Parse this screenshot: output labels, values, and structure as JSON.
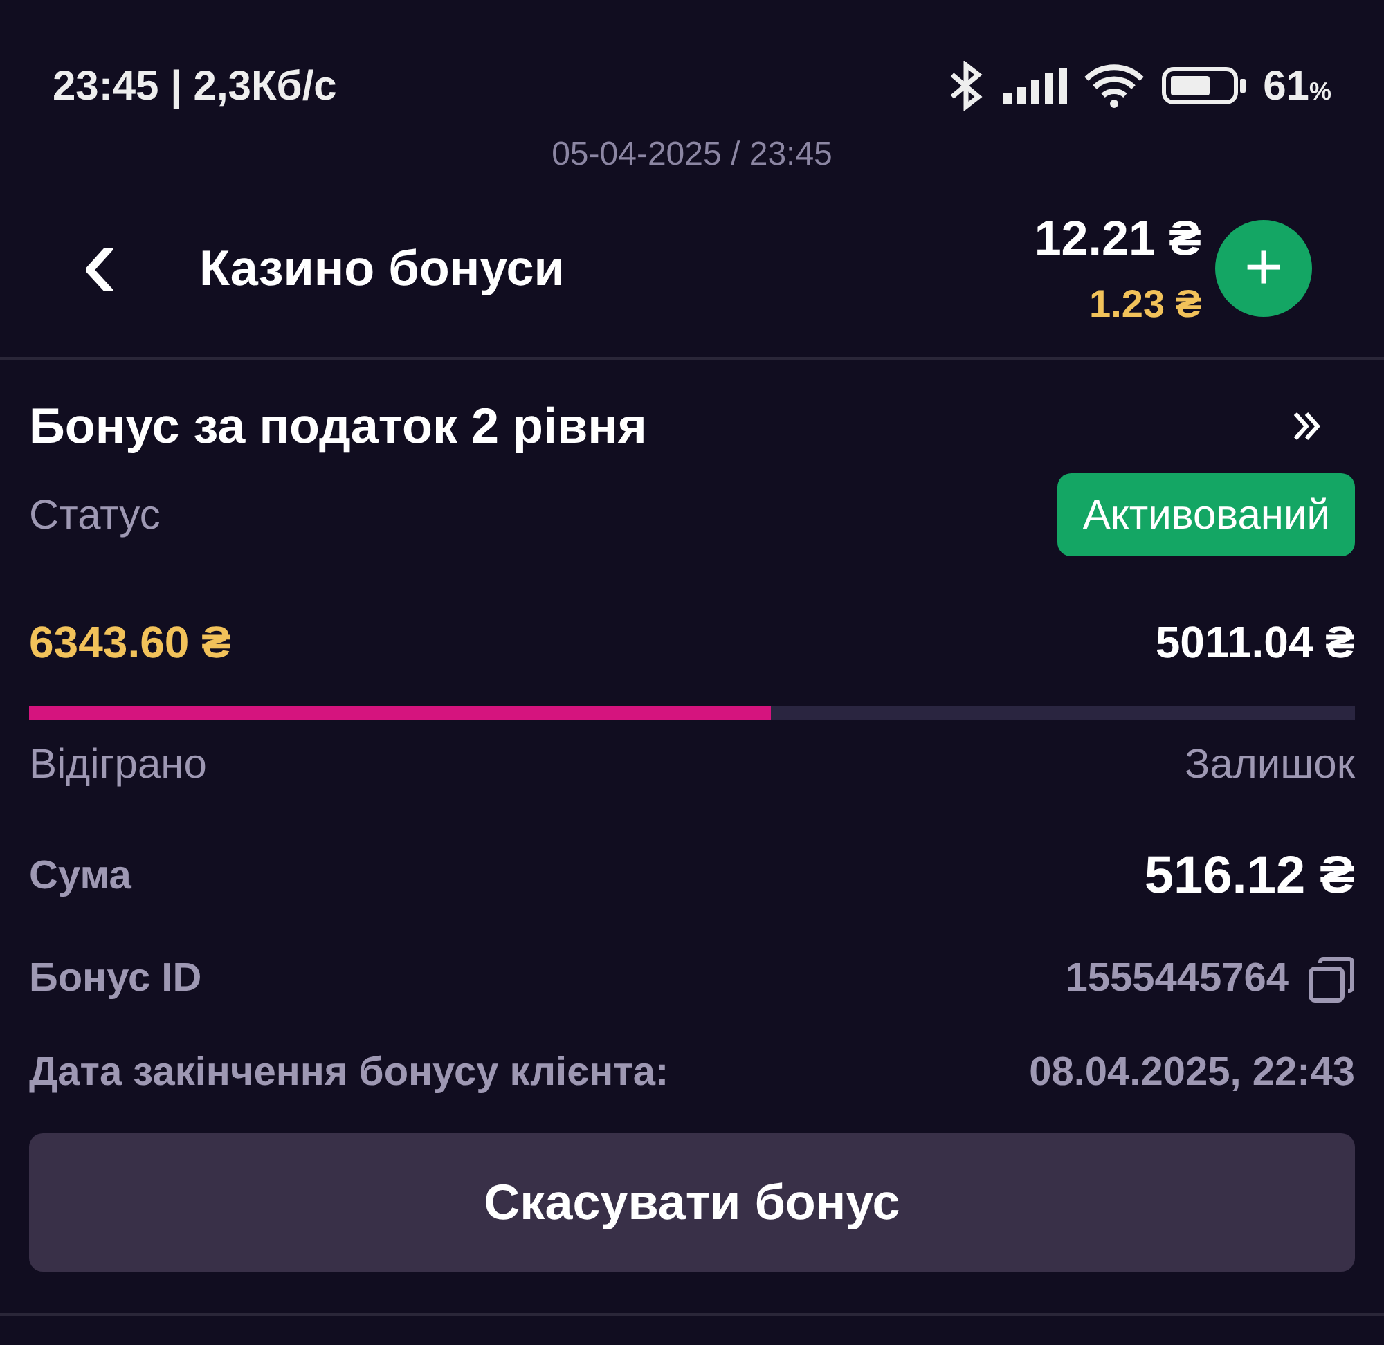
{
  "status_bar": {
    "time": "23:45 | 2,3Кб/с",
    "battery": "61",
    "battery_unit": "%"
  },
  "timestamp": "05-04-2025 / 23:45",
  "header": {
    "back": "‹",
    "title": "Казино бонуси",
    "balance": "12.21 ₴",
    "bonus_balance": "1.23 ₴",
    "add": "+"
  },
  "bonus": {
    "title": "Бонус за податок 2 рівня",
    "status_label": "Статус",
    "status": "Активований",
    "wagered": "6343.60 ₴",
    "remaining": "5011.04 ₴",
    "level": 0.56,
    "wagered_label": "Відіграно",
    "remaining_label": "Залишок",
    "details": [
      {
        "label": "Сума",
        "value": "516.12 ₴",
        "kind": "amount"
      },
      {
        "label": "Бонус ID",
        "value": "1555445764",
        "kind": "copy"
      },
      {
        "label": "Дата закінчення бонусу клієнта:",
        "value": "08.04.2025, 22:43",
        "kind": "plain"
      }
    ],
    "cancel_button": "Скасувати бонус"
  }
}
